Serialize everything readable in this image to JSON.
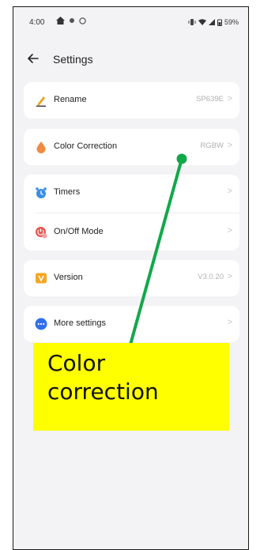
{
  "status_bar": {
    "time": "4:00",
    "battery": "59%"
  },
  "header": {
    "title": "Settings"
  },
  "settings": {
    "rename": {
      "label": "Rename",
      "value": "SP639E"
    },
    "color_correction": {
      "label": "Color Correction",
      "value": "RGBW"
    },
    "timers": {
      "label": "Timers"
    },
    "onoff_mode": {
      "label": "On/Off Mode"
    },
    "version": {
      "label": "Version",
      "value": "V3.0.20"
    },
    "more_settings": {
      "label": "More settings"
    },
    "chevron": ">"
  },
  "annotation": {
    "line1": "Color",
    "line2": "correction",
    "box_color": "#ffff00",
    "line_color": "#12a84a"
  },
  "colors": {
    "background": "#f3f3f5",
    "card": "#ffffff",
    "value_text": "#b0b0b0"
  }
}
